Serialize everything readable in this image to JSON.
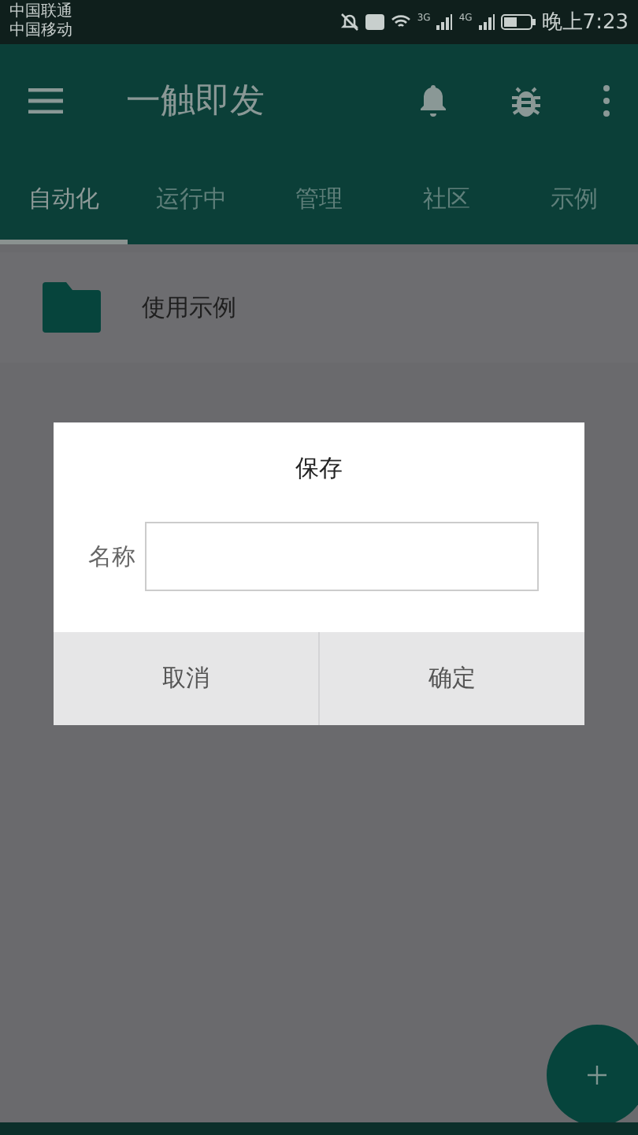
{
  "status_bar": {
    "carriers": [
      "中国联通",
      "中国移动"
    ],
    "network_labels": [
      "3G",
      "4G"
    ],
    "time": "晚上7:23"
  },
  "app_bar": {
    "title": "一触即发"
  },
  "tabs": [
    {
      "label": "自动化",
      "selected": true
    },
    {
      "label": "运行中",
      "selected": false
    },
    {
      "label": "管理",
      "selected": false
    },
    {
      "label": "社区",
      "selected": false
    },
    {
      "label": "示例",
      "selected": false
    }
  ],
  "folders": [
    {
      "name": "使用示例"
    }
  ],
  "dialog": {
    "title": "保存",
    "field_label": "名称",
    "buttons": [
      {
        "label": "取消"
      },
      {
        "label": "确定"
      }
    ]
  }
}
